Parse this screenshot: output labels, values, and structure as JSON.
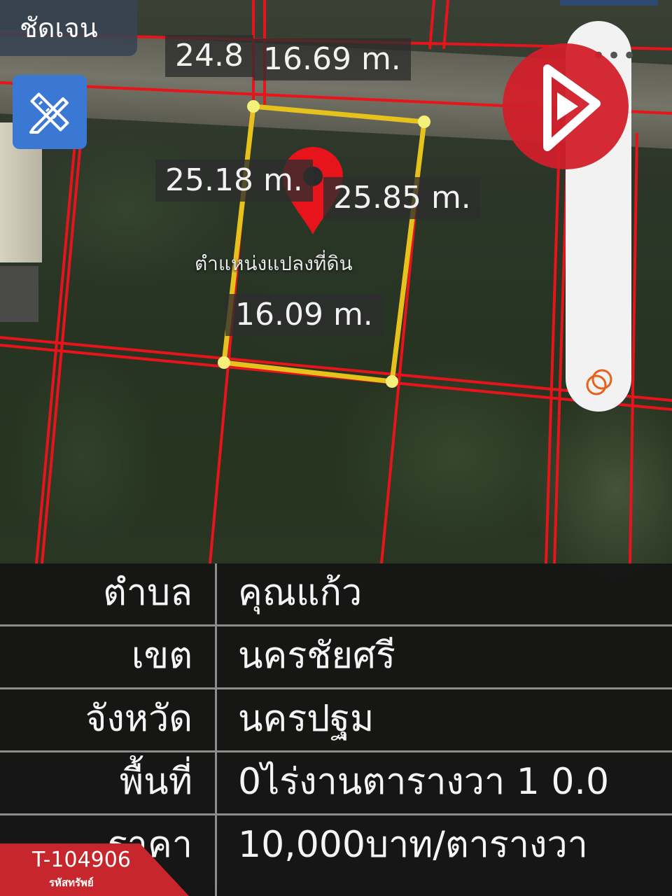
{
  "map": {
    "clarity_label": "ชัดเจน",
    "plot_location_label": "ตำแหน่งแปลงที่ดิน",
    "measurements": {
      "top_left_partial": "24.8",
      "top": "16.69 m.",
      "left": "25.18 m.",
      "right": "25.85 m.",
      "bottom": "16.09 m."
    },
    "tools": {
      "ruler_icon": "ruler-pencil-icon",
      "more_icon": "more-dots-icon",
      "coin_icon": "coins-icon"
    },
    "colors": {
      "boundary_red": "#e8141c",
      "plot_yellow": "#e6c21c",
      "brand_red": "#d11f2a",
      "tool_blue": "#3b78d4"
    }
  },
  "info": {
    "rows": [
      {
        "label": "ตำบล",
        "value": "คุณแก้ว"
      },
      {
        "label": "เขต",
        "value": "นครชัยศรี"
      },
      {
        "label": "จังหวัด",
        "value": "นครปฐม"
      },
      {
        "label": "พื้นที่",
        "value": "0ไร่งานตารางวา 1 0.0"
      },
      {
        "label": "ราคา",
        "value": "10,000บาท/ตารางวา"
      }
    ]
  },
  "property": {
    "code": "T-104906",
    "code_label": "รหัสทรัพย์"
  }
}
